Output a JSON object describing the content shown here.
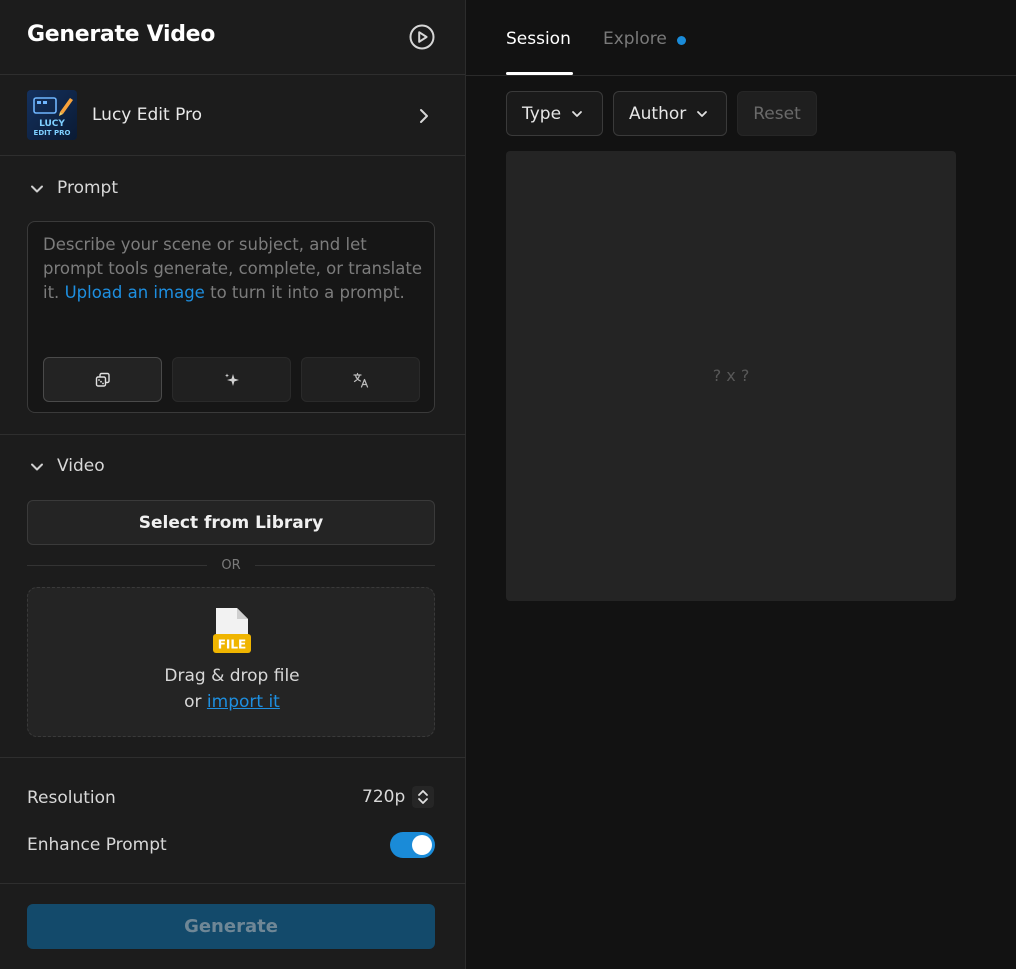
{
  "header": {
    "title": "Generate Video",
    "play_icon": "play-circle-icon"
  },
  "model": {
    "name": "Lucy Edit Pro",
    "thumb_line1": "LUCY",
    "thumb_line2": "EDIT PRO"
  },
  "prompt_section": {
    "label": "Prompt",
    "placeholder_before": "Describe your scene or subject, and let prompt tools generate, complete, or translate it.",
    "link_text": "Upload an image",
    "placeholder_after": "to turn it into a prompt.",
    "tools": [
      "dice-icon",
      "sparkle-icon",
      "translate-icon"
    ]
  },
  "video_section": {
    "label": "Video",
    "library_button": "Select from Library",
    "or_text": "OR",
    "file_badge": "FILE",
    "drop_text": "Drag & drop file",
    "or_prefix": "or",
    "import_link": "import it"
  },
  "settings": {
    "resolution_label": "Resolution",
    "resolution_value": "720p",
    "enhance_label": "Enhance Prompt",
    "enhance_on": true
  },
  "generate_button": "Generate",
  "tabs": {
    "session": "Session",
    "explore": "Explore"
  },
  "filters": {
    "type": "Type",
    "author": "Author",
    "reset": "Reset"
  },
  "preview": {
    "dims": "? x ?"
  },
  "colors": {
    "accent": "#1a8bd8",
    "generate_bg": "#134a6b",
    "file_badge": "#f0b500"
  }
}
